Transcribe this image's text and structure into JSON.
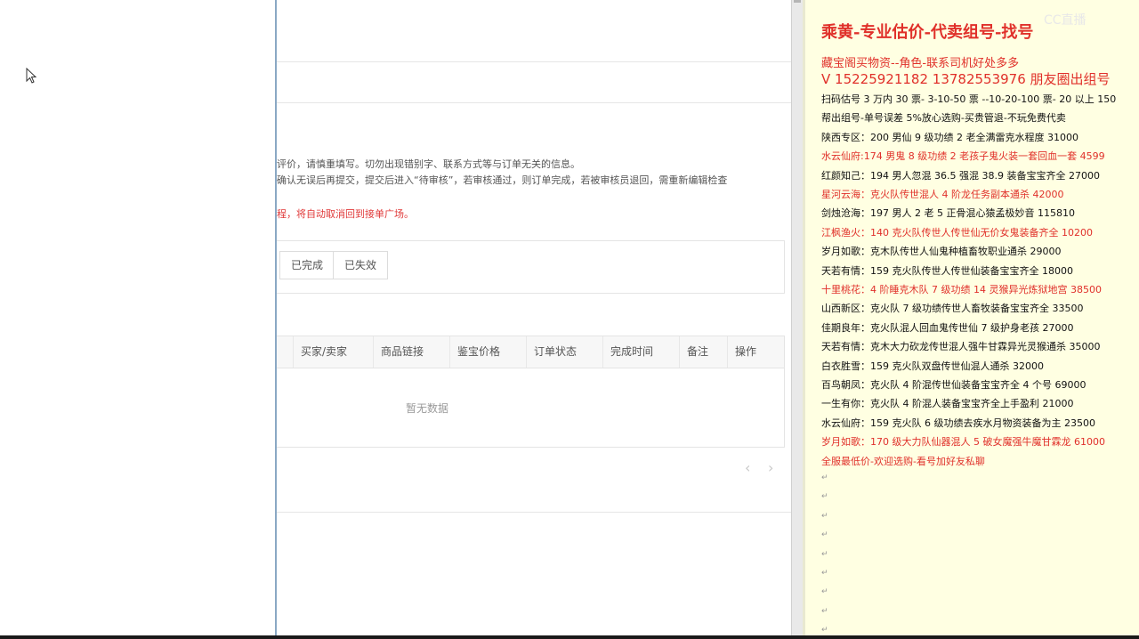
{
  "browser": {
    "notices": [
      "评价，请慎重填写。切勿出现错别字、联系方式等与订单无关的信息。",
      "确认无误后再提交，提交后进入“待审核”，若审核通过，则订单完成，若被审核员退回，需重新编辑检查",
      "程，将自动取消回到接单广场。"
    ],
    "tabs": [
      "已完成",
      "已失效"
    ],
    "table_headers": [
      "买家/卖家",
      "商品链接",
      "鉴宝价格",
      "订单状态",
      "完成时间",
      "备注",
      "操作"
    ],
    "empty_text": "暂无数据",
    "pager": {
      "prev": "‹",
      "next": "›"
    }
  },
  "doc": {
    "watermark": "CC直播",
    "title": "乘黄-专业估价-代卖组号-找号",
    "line1": "藏宝阁买物资--角色-联系司机好处多多",
    "phone": "V 15225921182   13782553976 朋友圈出组号",
    "lines": [
      {
        "text": "扫码估号 3 万内 30 票- 3-10-50 票  --10-20-100 票- 20 以上 150",
        "red": false
      },
      {
        "text": "帮出组号-单号误差 5%放心选购-买贵管退-不玩免费代卖",
        "red": false
      },
      {
        "text": "陕西专区：200 男仙 9 级功绩 2 老全满雷克水程度 31000",
        "red": false
      },
      {
        "text": "水云仙府:174 男鬼 8 级功绩 2 老孩子鬼火装一套回血一套 4599",
        "red": true
      },
      {
        "text": "红颜知己：194 男人忽混 36.5 强混 38.9 装备宝宝齐全 27000",
        "red": false
      },
      {
        "text": "星河云海：克火队传世混人 4 阶龙任务副本通杀 42000",
        "red": true
      },
      {
        "text": "剑烛沧海：197 男人 2 老 5 正骨混心猿孟极妙音 115810",
        "red": false
      },
      {
        "text": "江枫渔火：140 克火队传世人传世仙无价女鬼装备齐全 10200",
        "red": true
      },
      {
        "text": "岁月如歌：克木队传世人仙鬼种植畜牧职业通杀 29000",
        "red": false
      },
      {
        "text": "天若有情：159 克火队传世人传世仙装备宝宝齐全 18000",
        "red": false
      },
      {
        "text": "十里桃花：4 阶睡克木队 7 级功绩 14 灵猴异光炼狱地宫 38500",
        "red": true
      },
      {
        "text": "山西新区：克火队 7 级功绩传世人畜牧装备宝宝齐全 33500",
        "red": false
      },
      {
        "text": "佳期良年：克火队混人回血鬼传世仙 7 级护身老孩 27000",
        "red": false
      },
      {
        "text": "天若有情：克木大力砍龙传世混人强牛甘霖异光灵猴通杀 35000",
        "red": false
      },
      {
        "text": "白衣胜雪：159 克火队双盘传世仙混人通杀 32000",
        "red": false
      },
      {
        "text": "百鸟朝凤：克火队 4 阶混传世仙装备宝宝齐全 4 个号 69000",
        "red": false
      },
      {
        "text": "一生有你：克火队 4 阶混人装备宝宝齐全上手盈利 21000",
        "red": false
      },
      {
        "text": "水云仙府：159 克火队 6 级功绩去疾水月物资装备为主 23500",
        "red": false
      },
      {
        "text": "岁月如歌：170 级大力队仙器混人 5 破女魔强牛魔甘霖龙 61000",
        "red": true
      },
      {
        "text": "全服最低价-欢迎选购-看号加好友私聊",
        "red": true
      }
    ],
    "para_mark": "↵"
  }
}
